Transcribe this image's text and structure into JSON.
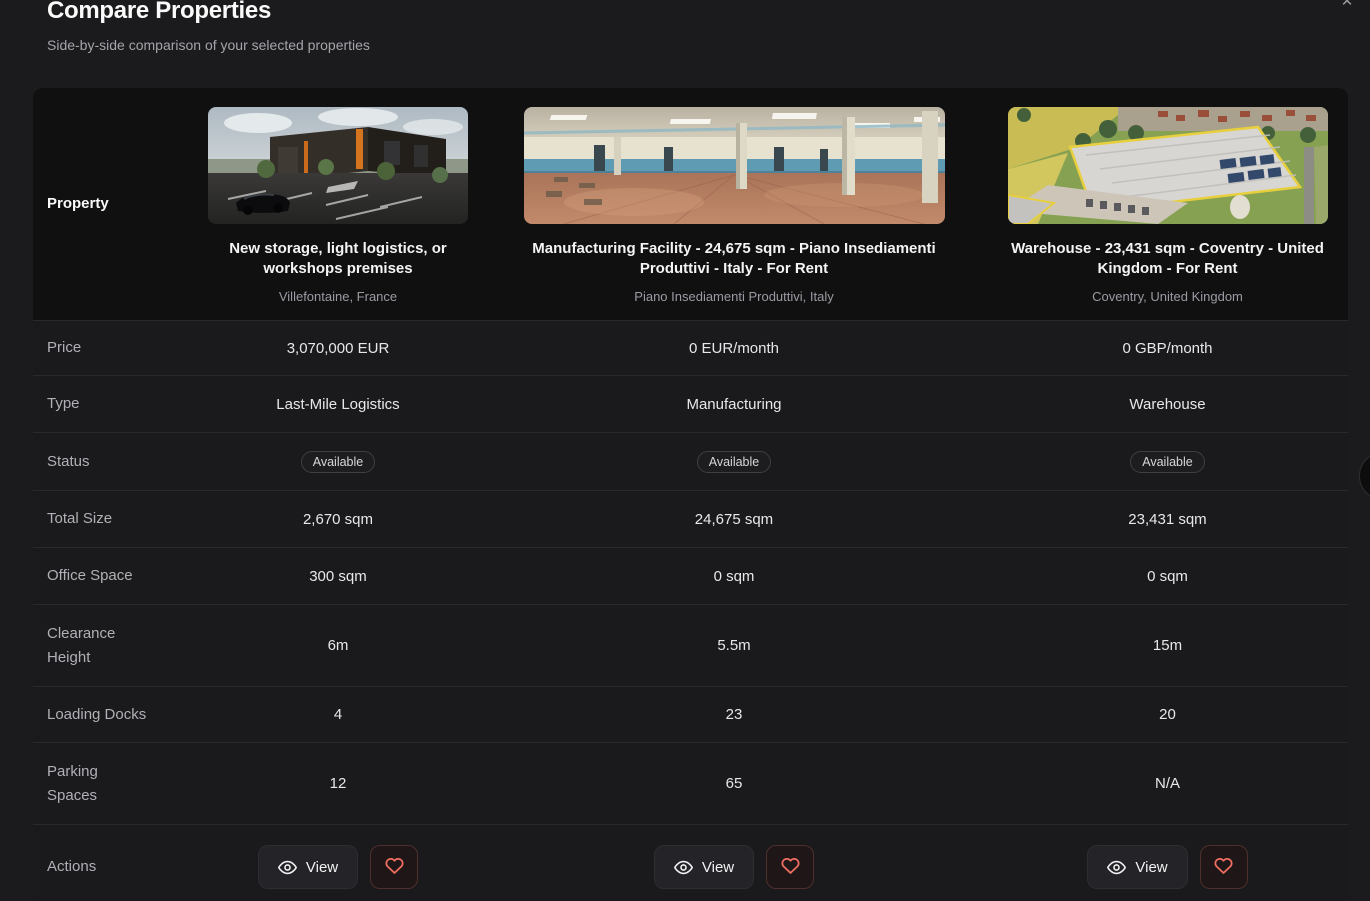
{
  "modal": {
    "title": "Compare Properties",
    "subtitle": "Side-by-side comparison of your selected properties",
    "close_icon": "x-icon",
    "close_glyph": "✕"
  },
  "comparison_table": {
    "row_labels": {
      "property": "Property",
      "price": "Price",
      "type": "Type",
      "status": "Status",
      "total_size": "Total Size",
      "office_space": "Office Space",
      "clearance_height": "Clearance Height",
      "loading_docks": "Loading Docks",
      "parking_spaces": "Parking Spaces",
      "actions": "Actions"
    },
    "properties": [
      {
        "title": "New storage, light logistics, or workshops premises",
        "location": "Villefontaine, France",
        "price": "3,070,000 EUR",
        "type": "Last-Mile Logistics",
        "status": "Available",
        "total_size": "2,670 sqm",
        "office_space": "300 sqm",
        "clearance_height": "6m",
        "loading_docks": "4",
        "parking_spaces": "12"
      },
      {
        "title": "Manufacturing Facility - 24,675 sqm - Piano Insediamenti Produttivi - Italy - For Rent",
        "location": "Piano Insediamenti Produttivi, Italy",
        "price": "0 EUR/month",
        "type": "Manufacturing",
        "status": "Available",
        "total_size": "24,675 sqm",
        "office_space": "0 sqm",
        "clearance_height": "5.5m",
        "loading_docks": "23",
        "parking_spaces": "65"
      },
      {
        "title": "Warehouse - 23,431 sqm - Coventry - United Kingdom - For Rent",
        "location": "Coventry, United Kingdom",
        "price": "0 GBP/month",
        "type": "Warehouse",
        "status": "Available",
        "total_size": "23,431 sqm",
        "office_space": "0 sqm",
        "clearance_height": "15m",
        "loading_docks": "20",
        "parking_spaces": "N/A"
      }
    ],
    "actions": {
      "view_label": "View",
      "view_icon": "eye-icon",
      "favorite_icon": "heart-icon"
    },
    "colors": {
      "heart_accent": "#ef6e61",
      "header_row_bg": "#101011",
      "page_bg": "#1b1b1d",
      "row_divider": "#29292c"
    }
  }
}
